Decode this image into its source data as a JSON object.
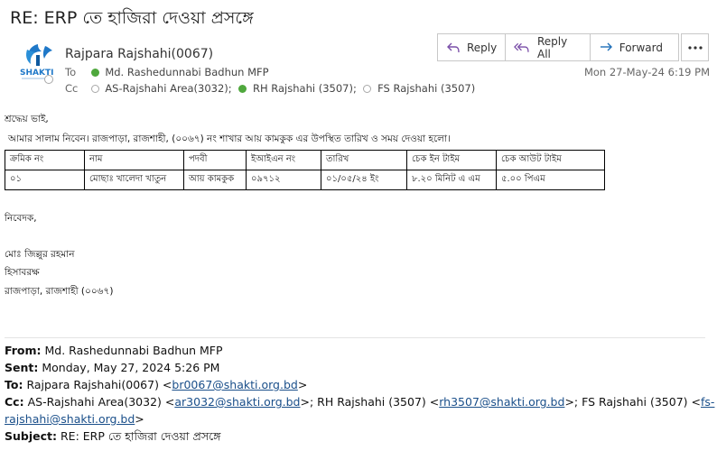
{
  "email": {
    "subject": "RE: ERP তে হাজিরা দেওয়া প্রসঙ্গে",
    "logo_text": "SHAKTI",
    "sender": "Rajpara Rajshahi(0067)",
    "to_label": "To",
    "to_value": "Md. Rashedunnabi Badhun MFP",
    "cc_label": "Cc",
    "cc": [
      "AS-Rajshahi Area(3032);",
      "RH Rajshahi (3507);",
      "FS Rajshahi (3507)"
    ],
    "datetime": "Mon 27-May-24 6:19 PM"
  },
  "actions": {
    "reply": "Reply",
    "reply_all": "Reply All",
    "forward": "Forward"
  },
  "body": {
    "greeting": "শ্রদ্ধেয় ভাই,",
    "intro": "আমার সালাম নিবেন। রাজপাড়া, রাজশাহী, (০০৬৭) নং শাখার আয় কামকুক এর উপস্থিত তারিখ ও সময় দেওয়া হলো।",
    "table": {
      "headers": [
        "ক্রমিক নং",
        "নাম",
        "পদবী",
        "ইআইএন নং",
        "তারিখ",
        "চেক ইন টাইম",
        "চেক আউট টাইম"
      ],
      "rows": [
        [
          "০১",
          "মোছাঃ খালেদা খাতুন",
          "আয় কামকুক",
          "০৯৭১২",
          "০১/০৫/২৪ ইং",
          "৮.২০ মিনিট এ এম",
          "৫.০০  পিএম"
        ]
      ]
    },
    "closing": "নিবেদক,",
    "signer_name": "মোঃ জিল্লুর রহমান",
    "signer_title": "হিসাবরক্ষ",
    "signer_branch": "রাজপাড়া,  রাজশাহী (০০৬৭)"
  },
  "forwarded": {
    "from_label": "From:",
    "from_value": "Md. Rashedunnabi Badhun MFP",
    "sent_label": "Sent:",
    "sent_value": "Monday, May 27, 2024 5:26 PM",
    "to_label": "To:",
    "to_name": "Rajpara Rajshahi(0067) <",
    "to_email": "br0067@shakti.org.bd",
    "to_close": ">",
    "cc_label": "Cc:",
    "cc_name1": "AS-Rajshahi Area(3032) <",
    "cc_email1": "ar3032@shakti.org.bd",
    "cc_mid1": ">; RH Rajshahi (3507) <",
    "cc_email2": "rh3507@shakti.org.bd",
    "cc_mid2": ">; FS Rajshahi (3507) <",
    "cc_email3_a": "fs-",
    "cc_email3_b": "rajshahi@shakti.org.bd",
    "cc_close": ">",
    "subject_label": "Subject:",
    "subject_value": "RE: ERP তে হাজিরা দেওয়া প্রসঙ্গে"
  },
  "colors": {
    "presence_green": "#4fa83d",
    "link": "#1a4f8a",
    "logo_blue": "#1f78c8"
  },
  "icons": [
    "reply-icon",
    "reply-all-icon",
    "forward-icon",
    "more-icon",
    "available-presence-icon",
    "offline-presence-icon"
  ]
}
